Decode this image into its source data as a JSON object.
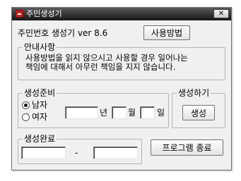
{
  "window": {
    "title": "주민생성기",
    "close_glyph": "✕"
  },
  "header": {
    "version_text": "주민번호 생성기 ver 8.6",
    "usage_button": "사용방법"
  },
  "notice": {
    "legend": "안내사항",
    "line1": "사용방법을 읽지 않으시고 사용할 경우 일어나는",
    "line2": "책임에 대해서 아무런 책임을 지지 않습니다."
  },
  "prep": {
    "legend": "생성준비",
    "gender_options": [
      "남자",
      "여자"
    ],
    "selected_gender": "남자",
    "year_label": "년",
    "month_label": "월",
    "day_label": "일",
    "year_value": "",
    "month_value": "",
    "day_value": ""
  },
  "generate": {
    "legend": "생성하기",
    "button": "생성"
  },
  "result": {
    "legend": "생성완료",
    "dash": "-",
    "front_value": "",
    "back_value": ""
  },
  "exit_button": "프로그램 종료"
}
